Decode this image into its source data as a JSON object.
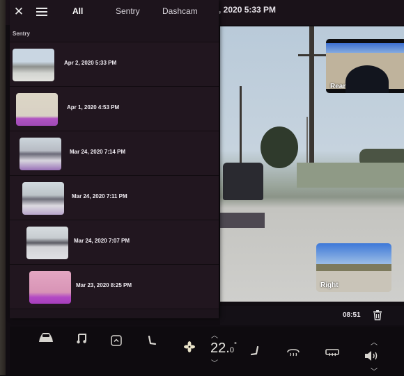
{
  "header": {
    "playback_datetime": ", 2020 5:33 PM"
  },
  "panel": {
    "tabs": [
      {
        "label": "All",
        "active": true
      },
      {
        "label": "Sentry",
        "active": false
      },
      {
        "label": "Dashcam",
        "active": false
      }
    ],
    "close_icon": "close-icon",
    "list_icon": "list-icon",
    "section_label": "Sentry",
    "clips": [
      {
        "date": "Apr 2, 2020 5:33 PM"
      },
      {
        "date": "Apr 1, 2020 4:53 PM"
      },
      {
        "date": "Mar 24, 2020 7:14 PM"
      },
      {
        "date": "Mar 24, 2020 7:11 PM"
      },
      {
        "date": "Mar 24, 2020 7:07 PM"
      },
      {
        "date": "Mar 23, 2020 8:25 PM"
      }
    ]
  },
  "video": {
    "cameras": [
      {
        "label": "Rear"
      },
      {
        "label": "Right"
      }
    ],
    "timecode": "08:51",
    "delete_icon": "trash-icon"
  },
  "dock": {
    "icons": [
      "car-icon",
      "music-note-icon",
      "app-launcher-icon",
      "driver-seat-icon",
      "fan-icon",
      "passenger-seat-icon",
      "front-defrost-icon",
      "rear-defrost-icon",
      "volume-icon"
    ],
    "temperature": "22.",
    "temperature_decimal": "0",
    "temperature_unit": "°"
  }
}
